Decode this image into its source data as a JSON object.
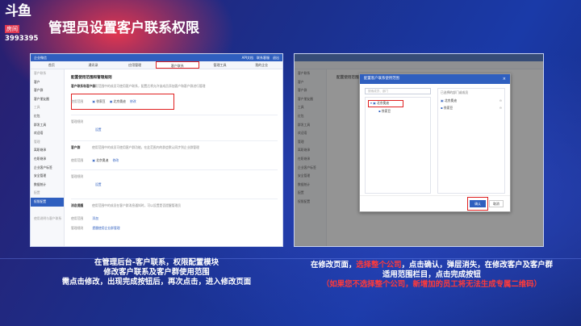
{
  "logo": {
    "mark": "斗鱼",
    "tag": "房间",
    "room": "3993395"
  },
  "page_title": "管理员设置客户联系权限",
  "left_shot": {
    "topbar_left": "企业微信",
    "topbar_right": [
      "API文档",
      "联系客服",
      "退出"
    ],
    "nav": [
      "首页",
      "通讯录",
      "应用管理",
      "客户联系",
      "管理工具",
      "我的企业"
    ],
    "nav_active_index": 3,
    "sidebar": [
      {
        "label": "客户联系",
        "type": "grp"
      },
      {
        "label": "客户",
        "type": "item"
      },
      {
        "label": "客户群",
        "type": "item"
      },
      {
        "label": "客户朋友圈",
        "type": "item"
      },
      {
        "label": "工具",
        "type": "grp"
      },
      {
        "label": "红包",
        "type": "item"
      },
      {
        "label": "群发工具",
        "type": "item"
      },
      {
        "label": "欢迎语",
        "type": "item"
      },
      {
        "label": "管理",
        "type": "grp"
      },
      {
        "label": "离职继承",
        "type": "item"
      },
      {
        "label": "在职继承",
        "type": "item"
      },
      {
        "label": "企业客户标签",
        "type": "item"
      },
      {
        "label": "安全管理",
        "type": "item"
      },
      {
        "label": "数据统计",
        "type": "item"
      },
      {
        "label": "配置",
        "type": "grp"
      },
      {
        "label": "权限配置",
        "type": "sel"
      },
      {
        "label": "",
        "type": "item"
      },
      {
        "label": "使用说明与客户联系",
        "type": "grp"
      }
    ],
    "heading": "配置使用范围和管理规则",
    "row1_label": "客户联系和客户群",
    "row1_desc": "使用范围中的成员可使用客户联系，配置后将允许该成员添加客户和客户群进行管理",
    "scope_label": "使用范围",
    "scope_members": [
      "徐家豆",
      "北京奥迪"
    ],
    "edit_link": "修改",
    "admin_label": "管理规则",
    "setting_link": "设置",
    "row2_label": "客户群",
    "row2_desc": "使用范围中的成员可使用客户群功能，在此范围内的群会默认同步到企业群管理",
    "row2_scope_member": "北京奥迪",
    "row3_admin_link": "设置",
    "row4_label": "消息提醒",
    "row4_desc": "使用范围中的成员在客户群消息通知时，可以设置是否提醒管理员",
    "row4_scope_link": "添加",
    "row4_rule_link": "提醒使用企业群管理"
  },
  "right_shot": {
    "bg_heading": "配置使用范围和管理规则",
    "bg_sidebar": [
      "客户联系",
      "客户",
      "客户群",
      "客户朋友圈",
      "工具",
      "红包",
      "群发工具",
      "欢迎语",
      "管理",
      "离职继承",
      "在职继承",
      "企业客户标签",
      "安全管理",
      "数据统计",
      "配置",
      "权限配置"
    ],
    "modal_title": "配置客户联系使用范围",
    "modal_close": "×",
    "search_placeholder": "搜索成员、部门",
    "tree_company": "北京奥迪",
    "tree_child": "徐家豆",
    "selected_title": "已选择的部门或成员",
    "selected_items": [
      "北京奥迪",
      "徐家豆"
    ],
    "ok": "确认",
    "cancel": "取消"
  },
  "captions": {
    "left": [
      "在管理后台-客户联系，权限配置模块",
      "修改客户联系及客户群使用范围",
      "需点击修改，出现完成按钮后，再次点击，进入修改页面"
    ],
    "right_l1_pre": "在修改页面，",
    "right_l1_red": "选择整个公司",
    "right_l1_post": "，点击确认，弹层消失，在修改客户及客户群",
    "right_l2": "适用范围栏目，点击完成按钮",
    "right_l3": "（如果您不选择整个公司，新增加的员工将无法生成专属二维码）"
  },
  "colors": {
    "accent_blue": "#2f5fbf",
    "highlight_red": "#e02020",
    "caption_red": "#ff3a3a"
  }
}
